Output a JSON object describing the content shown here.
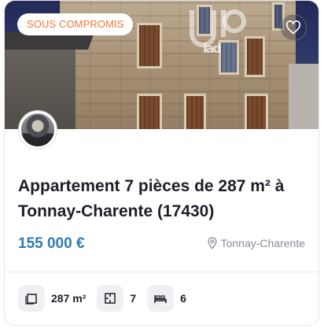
{
  "listing": {
    "badge": "SOUS COMPROMIS",
    "title": "Appartement 7 pièces de 287 m² à Tonnay-Charente (17430)",
    "price": "155 000 €",
    "location": "Tonnay-Charente",
    "watermark": "iad"
  },
  "features": [
    {
      "icon": "surface-area-icon",
      "value": "287 m²"
    },
    {
      "icon": "rooms-icon",
      "value": "7"
    },
    {
      "icon": "bedroom-icon",
      "value": "6"
    }
  ],
  "colors": {
    "badge_text": "#f0782f",
    "price": "#2f7cb1",
    "muted": "#8a8a95",
    "title": "#1e1e2a"
  }
}
